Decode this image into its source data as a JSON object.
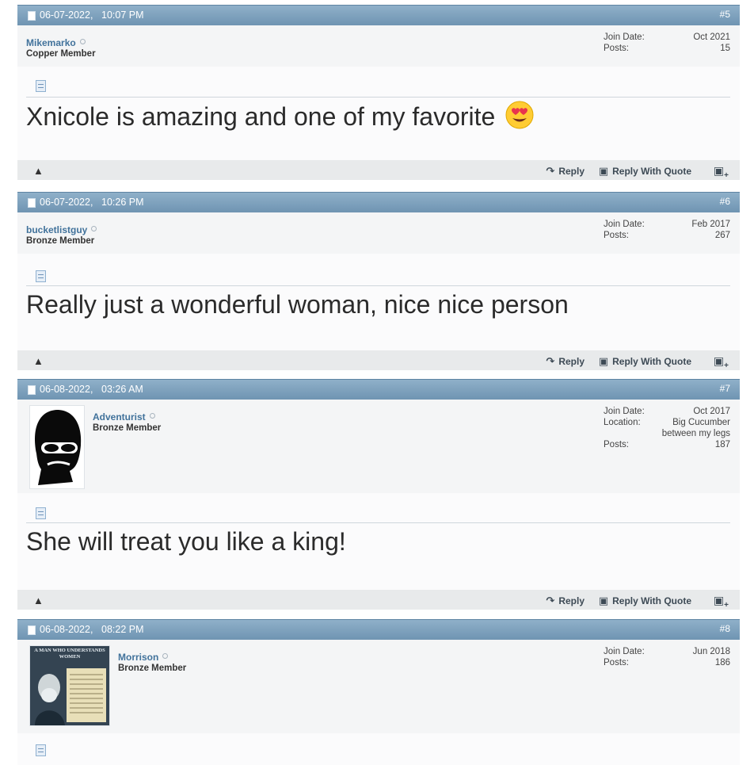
{
  "posts": [
    {
      "date": "06-07-2022,",
      "time": "10:07 PM",
      "number": "#5",
      "username": "Mikemarko",
      "rank": "Copper Member",
      "info": [
        {
          "label": "Join Date:",
          "value": "Oct 2021"
        },
        {
          "label": "Posts:",
          "value": "15"
        }
      ],
      "message": "Xnicole is amazing and one of my favorite",
      "emoji": "heart-eyes",
      "avatar": null
    },
    {
      "date": "06-07-2022,",
      "time": "10:26 PM",
      "number": "#6",
      "username": "bucketlistguy",
      "rank": "Bronze Member",
      "info": [
        {
          "label": "Join Date:",
          "value": "Feb 2017"
        },
        {
          "label": "Posts:",
          "value": "267"
        }
      ],
      "message": "Really just a wonderful woman, nice nice person",
      "avatar": null
    },
    {
      "date": "06-08-2022,",
      "time": "03:26 AM",
      "number": "#7",
      "username": "Adventurist",
      "rank": "Bronze Member",
      "info": [
        {
          "label": "Join Date:",
          "value": "Oct 2017"
        },
        {
          "label": "Location:",
          "value": "Big Cucumber between my legs"
        },
        {
          "label": "Posts:",
          "value": "187"
        }
      ],
      "message": "She will treat you like a king!",
      "avatar": "masked-silhouette"
    },
    {
      "date": "06-08-2022,",
      "time": "08:22 PM",
      "number": "#8",
      "username": "Morrison",
      "rank": "Bronze Member",
      "info": [
        {
          "label": "Join Date:",
          "value": "Jun 2018"
        },
        {
          "label": "Posts:",
          "value": "186"
        }
      ],
      "avatar": "book-cover",
      "avatar_text": "A MAN WHO UNDERSTANDS WOMEN"
    }
  ],
  "footer": {
    "reply_label": "Reply",
    "reply_quote_label": "Reply With Quote"
  }
}
